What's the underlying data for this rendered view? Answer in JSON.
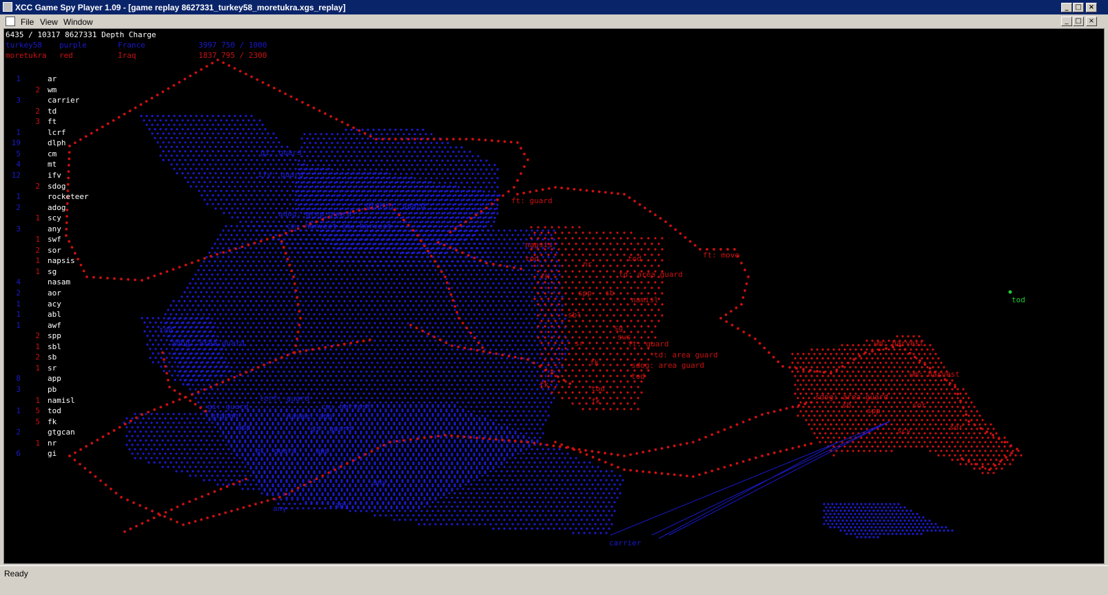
{
  "window": {
    "title": "XCC Game Spy Player 1.09 - [game replay 8627331_turkey58_moretukra.xgs_replay]",
    "buttons": [
      "_",
      "□",
      "×"
    ]
  },
  "menu": {
    "items": [
      "File",
      "View",
      "Window"
    ]
  },
  "status": {
    "text": "Ready"
  },
  "colors": {
    "blue": "#1a1acc",
    "red": "#cc1010",
    "green": "#22cc33",
    "white": "#ffffff"
  },
  "header": {
    "line1": "6435 / 10317 8627331 Depth Charge",
    "player1": {
      "name": "turkey58",
      "color": "purple",
      "country": "France",
      "stats": "3997 750 / 1000"
    },
    "player2": {
      "name": "moretukra",
      "color": "red",
      "country": "Iraq",
      "stats": "1837 795 / 2300"
    }
  },
  "units": [
    {
      "b": "1",
      "r": "",
      "n": "ar"
    },
    {
      "b": "",
      "r": "2",
      "n": "wm"
    },
    {
      "b": "3",
      "r": "",
      "n": "carrier"
    },
    {
      "b": "",
      "r": "2",
      "n": "td"
    },
    {
      "b": "",
      "r": "3",
      "n": "ft"
    },
    {
      "b": "1",
      "r": "",
      "n": "lcrf"
    },
    {
      "b": "19",
      "r": "",
      "n": "dlph"
    },
    {
      "b": "5",
      "r": "",
      "n": "cm"
    },
    {
      "b": "4",
      "r": "",
      "n": "mt"
    },
    {
      "b": "12",
      "r": "",
      "n": "ifv"
    },
    {
      "b": "",
      "r": "2",
      "n": "sdog"
    },
    {
      "b": "1",
      "r": "",
      "n": "rocketeer"
    },
    {
      "b": "2",
      "r": "",
      "n": "adog"
    },
    {
      "b": "",
      "r": "1",
      "n": "scy"
    },
    {
      "b": "3",
      "r": "",
      "n": "any"
    },
    {
      "b": "",
      "r": "1",
      "n": "swf"
    },
    {
      "b": "",
      "r": "2",
      "n": "sor"
    },
    {
      "b": "",
      "r": "1",
      "n": "napsis"
    },
    {
      "b": "",
      "r": "1",
      "n": "sg"
    },
    {
      "b": "4",
      "r": "",
      "n": "nasam"
    },
    {
      "b": "2",
      "r": "",
      "n": "aor"
    },
    {
      "b": "1",
      "r": "",
      "n": "acy"
    },
    {
      "b": "1",
      "r": "",
      "n": "abl"
    },
    {
      "b": "1",
      "r": "",
      "n": "awf"
    },
    {
      "b": "",
      "r": "2",
      "n": "spp"
    },
    {
      "b": "",
      "r": "1",
      "n": "sbl"
    },
    {
      "b": "",
      "r": "2",
      "n": "sb"
    },
    {
      "b": "",
      "r": "1",
      "n": "sr"
    },
    {
      "b": "8",
      "r": "",
      "n": "app"
    },
    {
      "b": "3",
      "r": "",
      "n": "pb"
    },
    {
      "b": "",
      "r": "1",
      "n": "namisl"
    },
    {
      "b": "1",
      "r": "5",
      "n": "tod"
    },
    {
      "b": "",
      "r": "5",
      "n": "fk"
    },
    {
      "b": "2",
      "r": "",
      "n": "gtgcan"
    },
    {
      "b": "",
      "r": "1",
      "n": "nr"
    },
    {
      "b": "6",
      "r": "",
      "n": "gi"
    }
  ],
  "map_labels": [
    {
      "t": "ft: guard",
      "c": "red"
    },
    {
      "t": "napsis",
      "c": "red"
    },
    {
      "t": "tod",
      "c": "red"
    },
    {
      "t": "fk",
      "c": "red"
    },
    {
      "t": "nr",
      "c": "red"
    },
    {
      "t": "tod",
      "c": "red"
    },
    {
      "t": "td: area guard",
      "c": "red"
    },
    {
      "t": "ft: move",
      "c": "red"
    },
    {
      "t": "spp",
      "c": "red"
    },
    {
      "t": "sb",
      "c": "red"
    },
    {
      "t": "namisl",
      "c": "red"
    },
    {
      "t": "sbl",
      "c": "red"
    },
    {
      "t": "sg",
      "c": "red"
    },
    {
      "t": "sws",
      "c": "red"
    },
    {
      "t": "ft: guard",
      "c": "red"
    },
    {
      "t": "td: area guard",
      "c": "red"
    },
    {
      "t": "sdog: area guard",
      "c": "red"
    },
    {
      "t": "tod",
      "c": "red"
    },
    {
      "t": "sr",
      "c": "red"
    },
    {
      "t": "fk",
      "c": "red"
    },
    {
      "t": "fk",
      "c": "red"
    },
    {
      "t": "tod",
      "c": "red"
    },
    {
      "t": "fk",
      "c": "red"
    },
    {
      "t": "wm: harvest",
      "c": "red"
    },
    {
      "t": "wm: harvest",
      "c": "red"
    },
    {
      "t": "sdog: area guard",
      "c": "red"
    },
    {
      "t": "sb",
      "c": "red"
    },
    {
      "t": "spp",
      "c": "red"
    },
    {
      "t": "sor",
      "c": "red"
    },
    {
      "t": "scy",
      "c": "red"
    },
    {
      "t": "sor",
      "c": "red"
    },
    {
      "t": "tod",
      "c": "green"
    },
    {
      "t": "gi: guard",
      "c": "blue"
    },
    {
      "t": "ifv: guard",
      "c": "blue"
    },
    {
      "t": "dlphin: guard",
      "c": "blue"
    },
    {
      "t": "adog: area guard",
      "c": "blue"
    },
    {
      "t": "cm: harvest cm: harvest",
      "c": "blue"
    },
    {
      "t": "gi: guard",
      "c": "blue"
    },
    {
      "t": "lcrf: guard",
      "c": "blue"
    },
    {
      "t": "cm: harvest",
      "c": "blue"
    },
    {
      "t": "nasam: app",
      "c": "blue"
    },
    {
      "t": "gi: guard",
      "c": "blue"
    },
    {
      "t": "gi: guard",
      "c": "blue"
    },
    {
      "t": "any",
      "c": "blue"
    },
    {
      "t": "any",
      "c": "blue"
    },
    {
      "t": "any",
      "c": "blue"
    },
    {
      "t": "adog: area guard",
      "c": "blue"
    },
    {
      "t": "tod",
      "c": "blue"
    },
    {
      "t": "carrier",
      "c": "blue"
    },
    {
      "t": "app",
      "c": "blue"
    },
    {
      "t": "app",
      "c": "blue"
    },
    {
      "t": "gtgcan",
      "c": "blue"
    }
  ]
}
